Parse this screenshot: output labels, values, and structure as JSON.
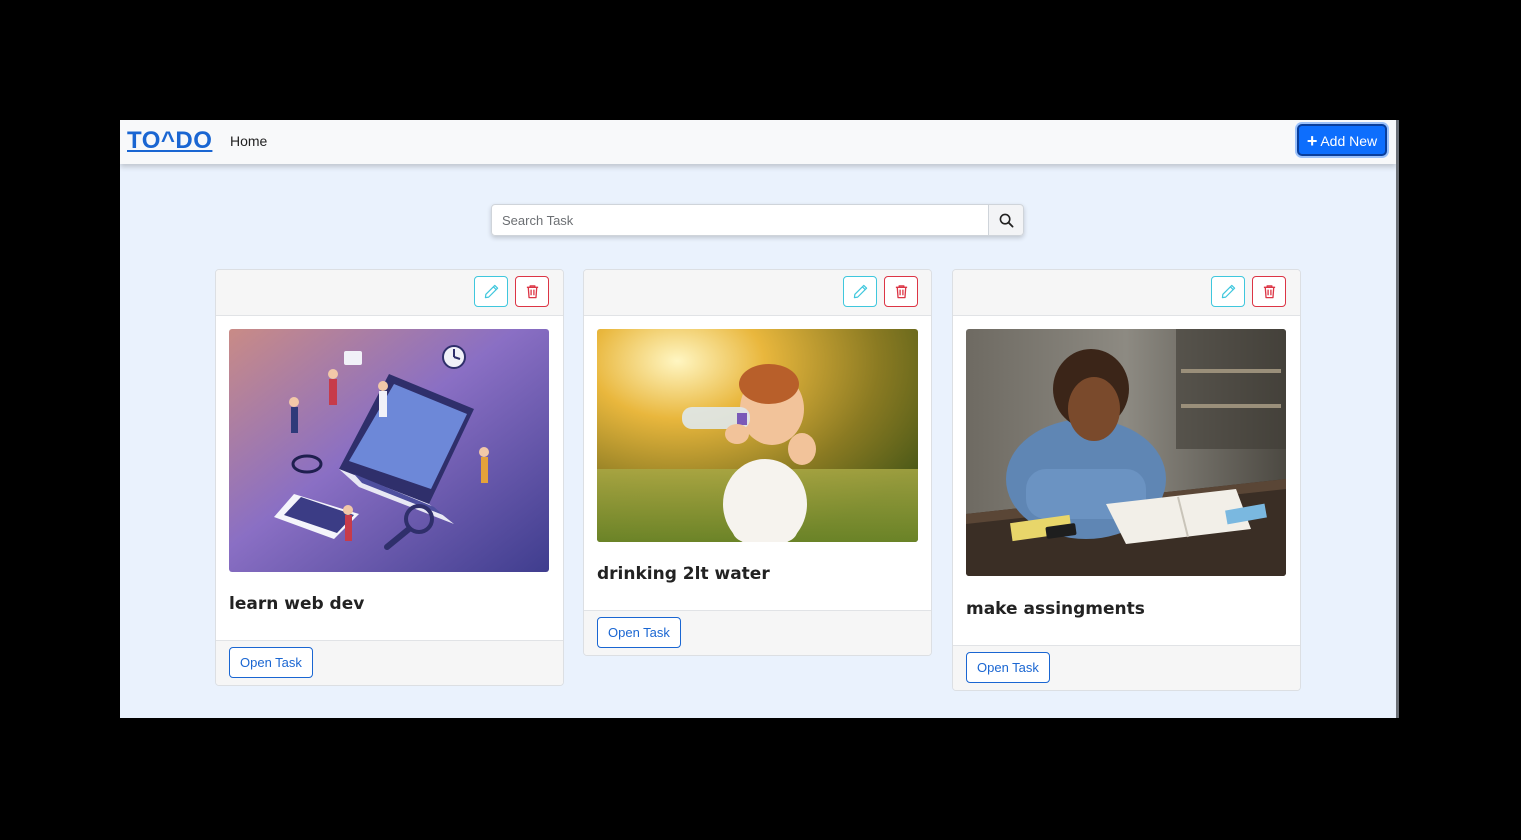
{
  "navbar": {
    "brand": "TO^DO",
    "home_link": "Home",
    "add_button_label": "Add New"
  },
  "search": {
    "placeholder": "Search Task"
  },
  "tasks": [
    {
      "title": "learn web dev",
      "image": "isometric-web-development-illustration",
      "open_label": "Open Task"
    },
    {
      "title": "drinking 2lt water",
      "image": "child-drinking-water-bottle-photo",
      "open_label": "Open Task"
    },
    {
      "title": "make assingments",
      "image": "student-studying-with-books-photo",
      "open_label": "Open Task"
    }
  ],
  "colors": {
    "primary": "#0d6efd",
    "brand": "#1a66d2",
    "edit": "#3fc7dd",
    "delete": "#dc3545",
    "background": "#eaf2fd"
  }
}
